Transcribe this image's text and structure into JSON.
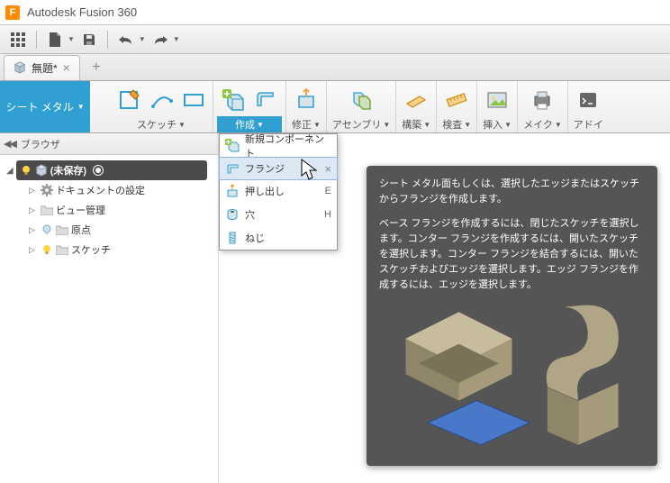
{
  "app": {
    "title": "Autodesk Fusion 360",
    "logo_letter": "F"
  },
  "tabs": {
    "items": [
      {
        "label": "無題*"
      }
    ]
  },
  "workspace": {
    "label": "シート メタル"
  },
  "ribbon": {
    "groups": [
      {
        "label": "スケッチ"
      },
      {
        "label": "作成",
        "active": true
      },
      {
        "label": "修正"
      },
      {
        "label": "アセンブリ"
      },
      {
        "label": "構築"
      },
      {
        "label": "検査"
      },
      {
        "label": "挿入"
      },
      {
        "label": "メイク"
      },
      {
        "label": "アドイ"
      }
    ]
  },
  "browser": {
    "title": "ブラウザ",
    "root": {
      "label": "(未保存)"
    },
    "items": [
      {
        "label": "ドキュメントの設定"
      },
      {
        "label": "ビュー管理"
      },
      {
        "label": "原点"
      },
      {
        "label": "スケッチ"
      }
    ]
  },
  "menu": {
    "items": [
      {
        "label": "新規コンポーネント"
      },
      {
        "label": "フランジ",
        "selected": true
      },
      {
        "label": "押し出し",
        "shortcut": "E"
      },
      {
        "label": "穴",
        "shortcut": "H"
      },
      {
        "label": "ねじ"
      }
    ]
  },
  "tooltip": {
    "p1": "シート メタル面もしくは、選択したエッジまたはスケッチからフランジを作成します。",
    "p2": "ベース フランジを作成するには、閉じたスケッチを選択します。コンター フランジを作成するには、開いたスケッチを選択します。コンター フランジを結合するには、開いたスケッチおよびエッジを選択します。エッジ フランジを作成するには、エッジを選択します。"
  }
}
